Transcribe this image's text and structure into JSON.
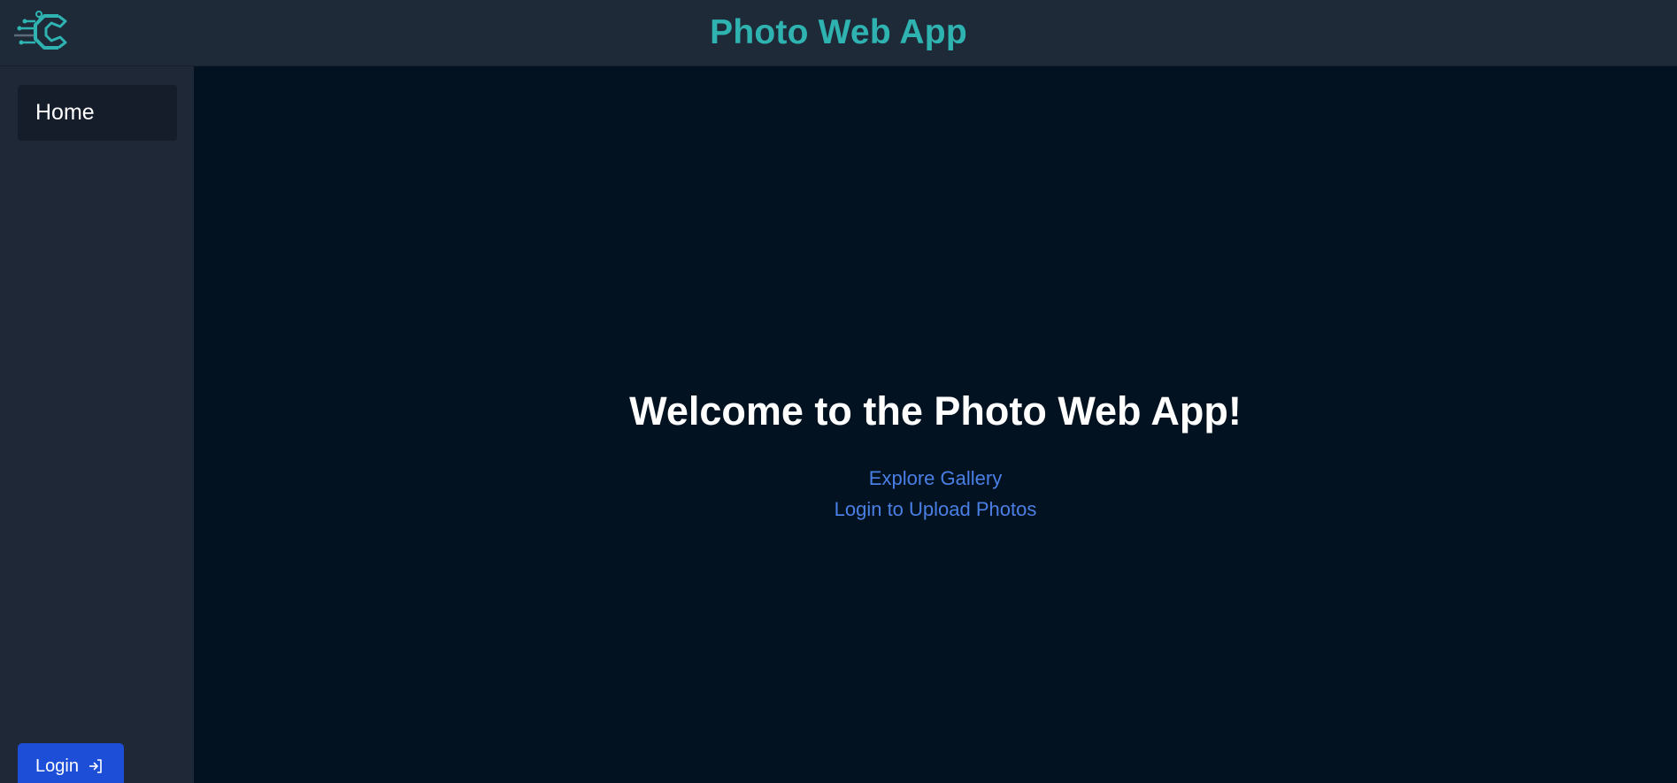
{
  "header": {
    "logo_icon": "circuit-c-logo-icon",
    "title": "Photo Web App",
    "title_color": "#2fb3b1"
  },
  "sidebar": {
    "items": [
      {
        "label": "Home"
      }
    ],
    "login_button": {
      "label": "Login",
      "icon": "sign-in-arrow-icon"
    }
  },
  "main": {
    "heading": "Welcome to the Photo Web App!",
    "links": [
      {
        "label": "Explore Gallery"
      },
      {
        "label": "Login to Upload Photos"
      }
    ],
    "link_color": "#4a7fe6"
  },
  "colors": {
    "header_bg": "#1e2a38",
    "sidebar_bg": "#1e2836",
    "main_bg": "#021220",
    "button_bg": "#1d4ed8"
  }
}
